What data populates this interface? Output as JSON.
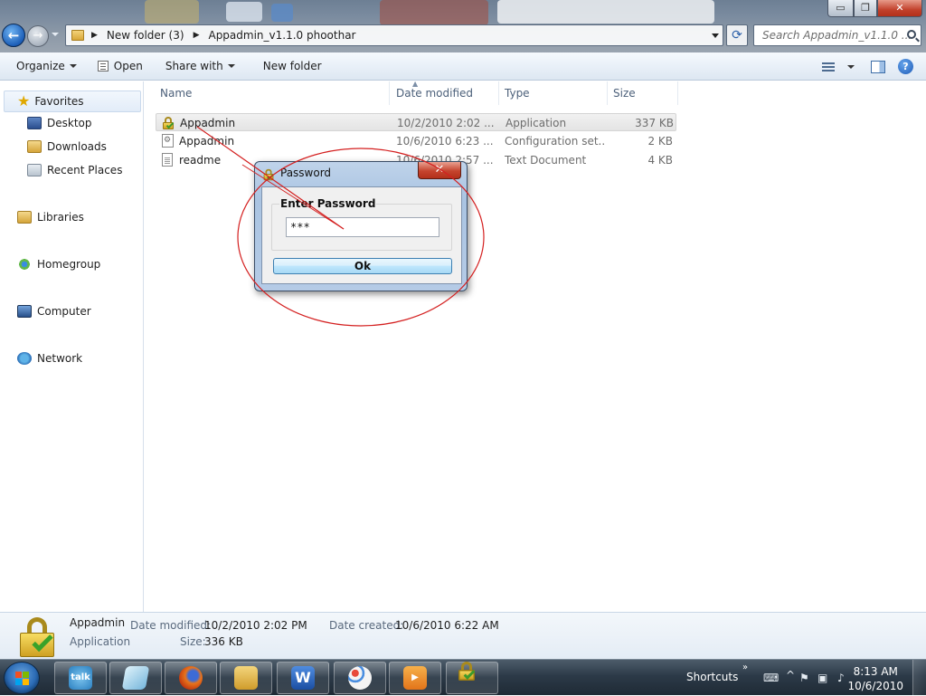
{
  "window": {
    "address": {
      "crumbs": [
        "New folder (3)",
        "Appadmin_v1.1.0  phoothar"
      ]
    },
    "search_placeholder": "Search Appadmin_v1.1.0 ...",
    "controls": {
      "minimize": "▭",
      "maximize": "❐",
      "close": "✕"
    }
  },
  "toolbar": {
    "organize": "Organize",
    "open": "Open",
    "share_with": "Share with",
    "new_folder": "New folder"
  },
  "nav": {
    "favorites": "Favorites",
    "desktop": "Desktop",
    "downloads": "Downloads",
    "recent_places": "Recent Places",
    "libraries": "Libraries",
    "homegroup": "Homegroup",
    "computer": "Computer",
    "network": "Network"
  },
  "columns": {
    "name": "Name",
    "date_modified": "Date modified",
    "type": "Type",
    "size": "Size"
  },
  "files": [
    {
      "name": "Appadmin",
      "date": "10/2/2010 2:02 ...",
      "type": "Application",
      "size": "337 KB",
      "icon": "lock-icon",
      "selected": true
    },
    {
      "name": "Appadmin",
      "date": "10/6/2010 6:23 ...",
      "type": "Configuration set...",
      "size": "2 KB",
      "icon": "config-file-icon",
      "selected": false
    },
    {
      "name": "readme",
      "date": "10/6/2010 2:57 ...",
      "type": "Text Document",
      "size": "4 KB",
      "icon": "text-file-icon",
      "selected": false
    }
  ],
  "dialog": {
    "title": "Password",
    "close": "✕",
    "group_label": "Enter Password",
    "input_value": "***",
    "ok_label": "Ok"
  },
  "details": {
    "name": "Appadmin",
    "type": "Application",
    "date_modified_label": "Date modified:",
    "date_modified": "10/2/2010 2:02 PM",
    "size_label": "Size:",
    "size": "336 KB",
    "date_created_label": "Date created:",
    "date_created": "10/6/2010 6:22 AM"
  },
  "taskbar": {
    "apps": [
      {
        "name": "talk-app",
        "label": "talk"
      },
      {
        "name": "notepad-app",
        "label": ""
      },
      {
        "name": "firefox-app",
        "label": ""
      },
      {
        "name": "explorer-app",
        "label": ""
      },
      {
        "name": "word-app",
        "label": "W"
      },
      {
        "name": "paint-app",
        "label": ""
      },
      {
        "name": "media-player-app",
        "label": ""
      },
      {
        "name": "appadmin-app",
        "label": ""
      }
    ],
    "shortcuts": "Shortcuts",
    "time": "8:13 AM",
    "date": "10/6/2010"
  },
  "colors": {
    "annotation": "#d42020",
    "accent": "#1d5fb9"
  }
}
